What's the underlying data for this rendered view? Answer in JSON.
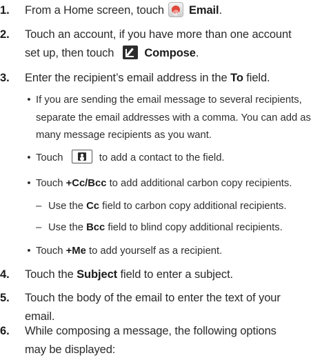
{
  "steps": [
    {
      "num": "1.",
      "a": "From a Home screen, touch",
      "b": "Email",
      "c": "."
    },
    {
      "num": "2.",
      "a": "Touch an account, if you have more than one account",
      "b": "set up, then touch",
      "c": "Compose",
      "d": "."
    },
    {
      "num": "3.",
      "a": "Enter the recipient’s email address in the",
      "b": "To",
      "c": "field."
    },
    {
      "num": "4.",
      "a": "Touch the",
      "b": "Subject",
      "c": "field to enter a subject."
    },
    {
      "num": "5.",
      "a": "Touch the body of the email to enter the text of your",
      "b": "email."
    },
    {
      "num": "6.",
      "a": "While composing a message, the following options",
      "b": "may be displayed:"
    }
  ],
  "bullets": {
    "dot": "•",
    "several": [
      "If you are sending the email message to several recipients,",
      "separate the email addresses with a comma. You can add as",
      "many message recipients as you want."
    ],
    "contact": {
      "a": "Touch",
      "b": "to add a contact to the field."
    },
    "cc": {
      "a": "Touch",
      "b": "+Cc/Bcc",
      "c": "to add additional carbon copy recipients."
    },
    "me": {
      "a": "Touch",
      "b": "+Me",
      "c": "to add yourself as a recipient."
    }
  },
  "dashes": {
    "mark": "–",
    "cc": {
      "a": "Use the",
      "b": "Cc",
      "c": "field to carbon copy additional recipients."
    },
    "bcc": {
      "a": "Use the",
      "b": "Bcc",
      "c": "field to blind copy additional recipients."
    }
  },
  "icons": [
    "email-app-icon",
    "compose-icon",
    "contact-picker-icon"
  ]
}
